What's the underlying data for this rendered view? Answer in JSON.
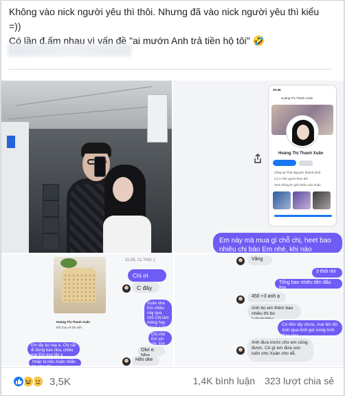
{
  "post": {
    "caption_line1": "Không vào nick người yêu thì thôi. Nhưng đã vào nick người yêu thì kiểu",
    "caption_line2": "=))",
    "caption_line3": "Có lần đ.ấm nhau vì vấn đề \"ai mướn Anh trả tiền hộ tôi\" 🤣"
  },
  "profile_shot": {
    "time": "20:36",
    "name_bar": "Hoàng Thị Thanh Xuân",
    "profile_name": "Hoàng Thị Thanh Xuân",
    "lives_in": "Sống tại Thái Nguyên (thành phố)",
    "followers": "Có 2.700 người theo dõi",
    "see_info": "Xem thông tin giới thiệu của Xuân"
  },
  "chat": {
    "big_bubble": "Em này mà mua gì chỗ chị, heet bao nhiêu chị báo Em nhé, khi nào",
    "date_label": "11:05, 21 THG 1",
    "product_title": "Hoàng Thị Thanh Xuân",
    "product_sub": "Đã chia sẻ bài viết",
    "left_bubbles": [
      "Em lấy áo này a. Chị cắt đi đừng bán nha, chiều mai Em qua lấy a",
      "Hoặc là nếu Xuân nhắn tin cho chị"
    ],
    "chi_oi": "Chị ơi",
    "c_day": "C đây",
    "middle_me": "Xuân nhà Em chiều nay qua chỗ Chị làm móng hay sao ý. Làm xong chị báo lại thanh toán rồi nha, để Em gửi tiền ạ",
    "middle_me2": "Chị cho Em xin stk, Em bank qua luôn cho nha",
    "oke_them": "Oke e. Nha",
    "hihi": "Hihi oke",
    "right_vang": "Vâng",
    "right_3thoi": "3 thôi nhỉ",
    "right_tong": "Tổng bao nhiêu tiền đấu Em",
    "right_amount": "450 +3 anh ạ",
    "right_anh_bo": "Anh bo em thêm bao nhiêu thì bo hahahahha",
    "right_co_tien": "Có tiền lấy chưa, mai lên đó Anh qua Anh gọi xong Anh đưa cho",
    "right_anh_dua": "Anh đưa trước cho em cũng được. Có gì em đưa son luôn cho Xuân cho dễ."
  },
  "footer": {
    "reaction_count": "3,5K",
    "comments": "1,4K bình luận",
    "shares": "323 lượt chia sẻ"
  },
  "colors": {
    "accent": "#1877f2",
    "chat_me": "#6f5cf5",
    "chat_them": "#e6e8ec"
  },
  "icons": [
    "like-reaction-icon",
    "haha-reaction-icon",
    "sad-reaction-icon",
    "share-icon"
  ]
}
